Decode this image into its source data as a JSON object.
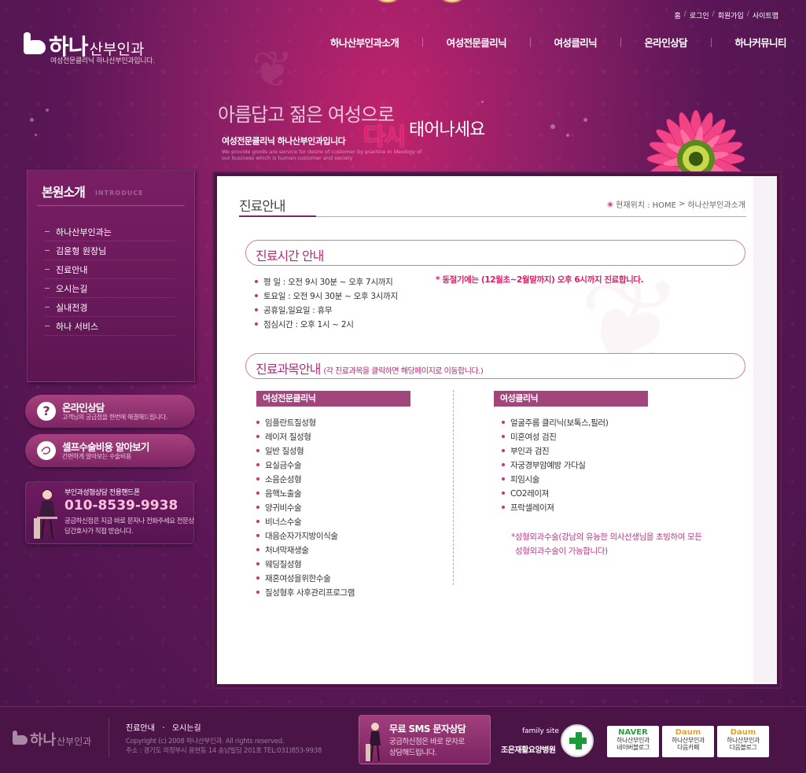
{
  "header": {
    "logo_main": "하나",
    "logo_sub": "산부인과",
    "tagline": "여성전문클리닉 하나산부인과입니다.",
    "util_links": [
      "홈",
      "로그인",
      "회원가입",
      "사이트맵"
    ],
    "nav": [
      "하나산부인과소개",
      "여성전문클리닉",
      "여성클리닉",
      "온라인상담",
      "하나커뮤니티"
    ]
  },
  "hero": {
    "line1": "아름답고 젊은 여성으로",
    "line2": "여성전문클리닉 하나산부인과입니다",
    "highlight": "다시",
    "tail": "태어나세요",
    "english": "We provide goods are service for desire of customer by practice in ideology of our business which is human customer and society"
  },
  "sidebar": {
    "title": "본원소개",
    "title_en": "INTRODUCE",
    "items": [
      {
        "label": "하나산부인과는"
      },
      {
        "label": "김윤형 원장님"
      },
      {
        "label": "진료안내"
      },
      {
        "label": "오시는길"
      },
      {
        "label": "실내전경"
      },
      {
        "label": "하나 서비스"
      }
    ],
    "online": {
      "title": "온라인상담",
      "desc": "고객님의 궁금점을 한번에 해결해드립니다.",
      "icon": "?"
    },
    "self": {
      "title": "셀프수술비용 알아보기",
      "desc": "간편하게 알아보는 수술비용"
    },
    "phone": {
      "label": "부인과성형상담 전용핸드폰",
      "number": "010-8539-9938",
      "desc": "궁금하신점은 지금 바로 문자나 전화주세요 전문상담간호사가 직접 받습니다."
    }
  },
  "content": {
    "page_title": "진료안내",
    "location_prefix": "현재위치 : HOME",
    "location_current": "하나산부인과소개",
    "hours_title": "진료시간 안내",
    "hours": [
      "평    일 : 오전 9시 30분 ~ 오후 7시까지",
      "토요일 : 오전 9시 30분 ~ 오후 3시까지",
      "공휴일,일요일 : 휴무",
      "점심시간 : 오후 1시 ~ 2시"
    ],
    "winter_note": "* 동절기에는 (12월초~2월말까지) 오후 6시까지 진료합니다.",
    "subjects_title": "진료과목안내",
    "subjects_sub": "(각 진료과목을 클릭하면 해당페이지로 이동합니다.)",
    "col1": {
      "header": "여성전문클리닉",
      "items": [
        "임플란트질성형",
        "레이저 질성형",
        "일반 질성형",
        "요실금수술",
        "소음순성형",
        "음핵노출술",
        "양귀비수술",
        "비너스수술",
        "대음순자가지방이식술",
        "처녀막재생술",
        "웨딩질성형",
        "재혼여성을위한수술",
        "질성형후 사후관리프로그램"
      ]
    },
    "col2": {
      "header": "여성클리닉",
      "items": [
        "얼굴주름 클리닉(보톡스,필러)",
        "미혼여성 검진",
        "부인과 검진",
        "자궁경부암예방 가다실",
        "피임시술",
        "CO2레이져",
        "프락셀레이져"
      ]
    },
    "note_line1": "*성형외과수술(강남의 유능한 의사선생님을 초빙하여 모든",
    "note_line2": "성형외과수술이 가능합니다)"
  },
  "footer": {
    "logo_main": "하나",
    "logo_sub": "산부인과",
    "links": [
      "진료안내",
      "오시는길"
    ],
    "copyright": "Copyright (c) 2008 하나산부인과. All rights reserved.",
    "address": "주소 : 경기도 의정부시 용현동 14 송남빌딩 201호 TEL:031)853-9938",
    "sms_title": "무료 SMS 문자상담",
    "sms_desc1": "궁금하신점은 바로 문자로",
    "sms_desc2": "상담해드립니다.",
    "family_label": "family site",
    "family_name": "조은재활요양병원",
    "blogs": [
      {
        "brand": "NAVER",
        "l1": "하나산부인과",
        "l2": "네이버블로그",
        "color": "#2aa33f"
      },
      {
        "brand": "Daum",
        "l1": "하나산부인과",
        "l2": "다음카페",
        "color": "#e8a317"
      },
      {
        "brand": "Daum",
        "l1": "하나산부인과",
        "l2": "다음블로그",
        "color": "#e8a317"
      }
    ]
  }
}
